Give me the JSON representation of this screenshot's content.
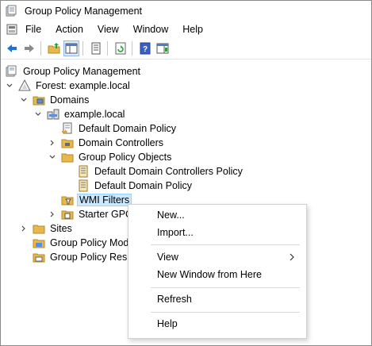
{
  "window": {
    "title": "Group Policy Management"
  },
  "menubar": {
    "items": [
      "File",
      "Action",
      "View",
      "Window",
      "Help"
    ]
  },
  "toolbar": {
    "buttons": [
      "back-icon",
      "forward-icon",
      "up-folder-icon",
      "show-hide-console-tree-icon",
      "properties-icon",
      "refresh-icon",
      "help-icon",
      "show-action-pane-icon"
    ]
  },
  "tree": {
    "root": "Group Policy Management",
    "forest": "Forest: example.local",
    "domains": "Domains",
    "domain": "example.local",
    "default_domain_policy": "Default Domain Policy",
    "domain_controllers": "Domain Controllers",
    "gpo": "Group Policy Objects",
    "gpo_dc_policy": "Default Domain Controllers Policy",
    "gpo_domain_policy": "Default Domain Policy",
    "wmi_filters": "WMI Filters",
    "starter_gpos": "Starter GPC",
    "sites": "Sites",
    "gp_modeling": "Group Policy Mod",
    "gp_results": "Group Policy Resu"
  },
  "context_menu": {
    "new": "New...",
    "import": "Import...",
    "view": "View",
    "new_window": "New Window from Here",
    "refresh": "Refresh",
    "help": "Help"
  },
  "colors": {
    "selection_bg": "#cce8ff",
    "selection_border": "#99d1ff",
    "folder": "#e8b94a"
  }
}
